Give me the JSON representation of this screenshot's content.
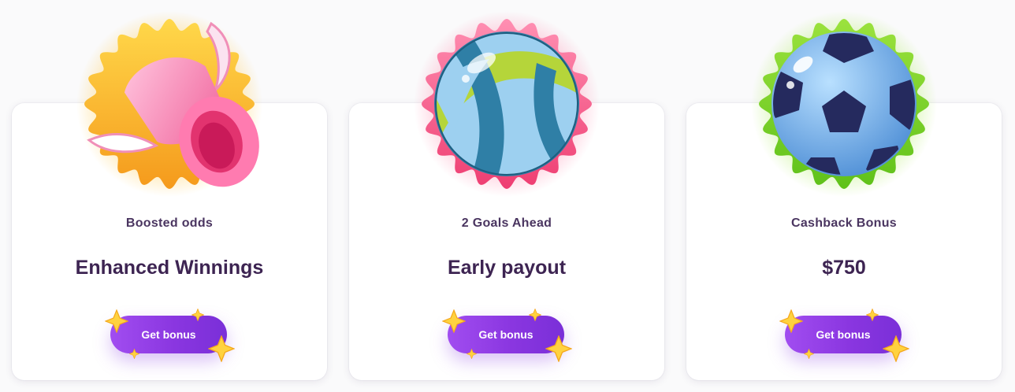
{
  "cards": [
    {
      "subtitle": "Boosted odds",
      "title": "Enhanced Winnings",
      "button": "Get bonus",
      "icon": "magic-hat-icon",
      "accent": "#f7b733"
    },
    {
      "subtitle": "2 Goals Ahead",
      "title": "Early payout",
      "button": "Get bonus",
      "icon": "volleyball-icon",
      "accent": "#f4577e"
    },
    {
      "subtitle": "Cashback Bonus",
      "title": "$750",
      "button": "Get bonus",
      "icon": "soccer-ball-icon",
      "accent": "#7ed321"
    }
  ],
  "colors": {
    "button_gradient_start": "#a14df0",
    "button_gradient_end": "#7a2fd8",
    "star": "#ffd23f",
    "text_dark": "#3d2452"
  }
}
